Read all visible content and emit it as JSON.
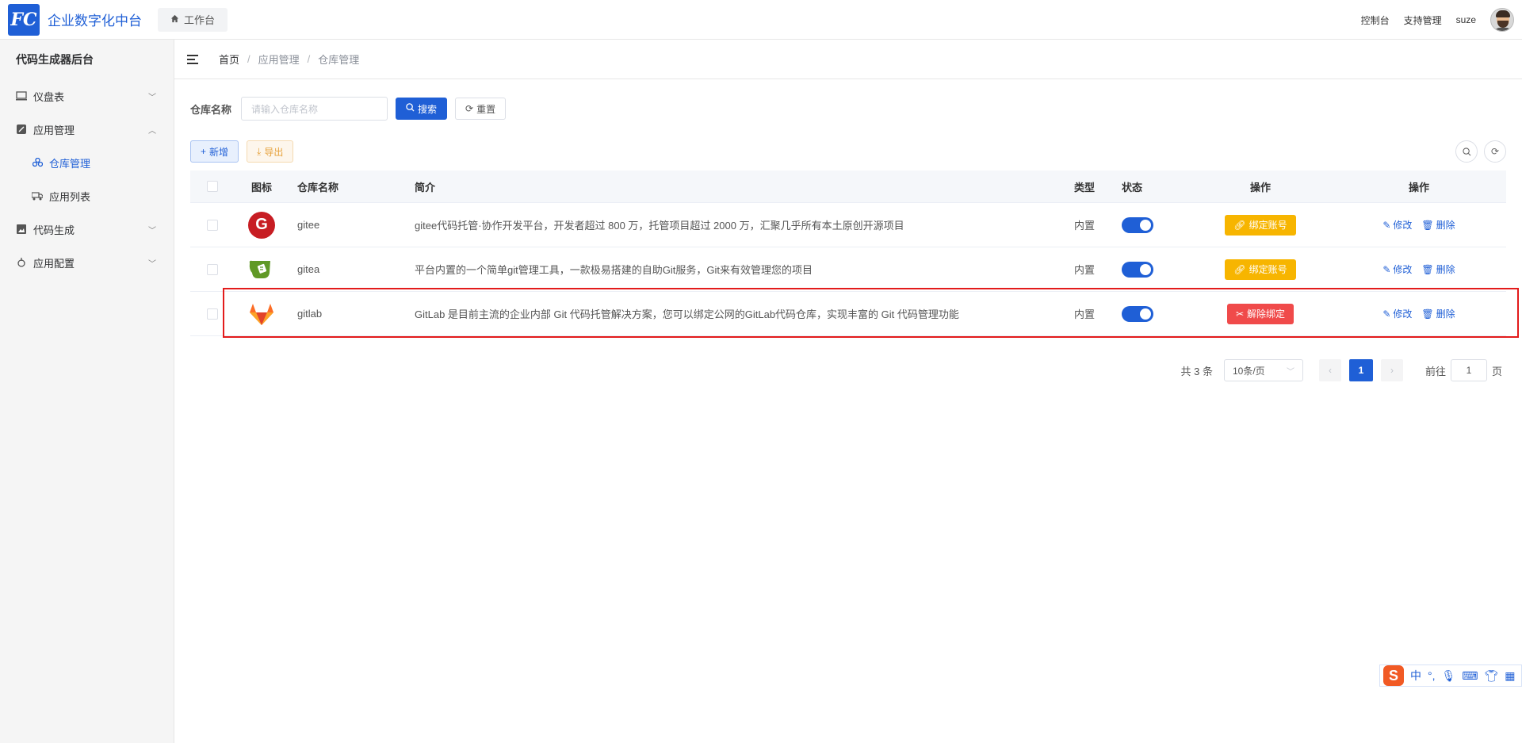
{
  "header": {
    "logo_text": "FC",
    "app_title": "企业数字化中台",
    "workbench_tab": "工作台",
    "links": [
      "控制台",
      "支持管理",
      "suze"
    ]
  },
  "sidebar": {
    "title": "代码生成器后台",
    "items": [
      {
        "label": "仪盘表",
        "icon": "monitor-icon",
        "chevron": "down"
      },
      {
        "label": "应用管理",
        "icon": "app-icon",
        "chevron": "up"
      },
      {
        "label": "仓库管理",
        "icon": "repo-icon",
        "active": true
      },
      {
        "label": "应用列表",
        "icon": "truck-icon"
      },
      {
        "label": "代码生成",
        "icon": "image-icon",
        "chevron": "down"
      },
      {
        "label": "应用配置",
        "icon": "config-icon",
        "chevron": "down"
      }
    ]
  },
  "breadcrumb": [
    "首页",
    "应用管理",
    "仓库管理"
  ],
  "search": {
    "label": "仓库名称",
    "placeholder": "请输入仓库名称",
    "search_btn": "搜索",
    "reset_btn": "重置"
  },
  "actions": {
    "add": "新增",
    "export": "导出"
  },
  "table": {
    "headers": [
      "图标",
      "仓库名称",
      "简介",
      "类型",
      "状态",
      "操作",
      "操作"
    ],
    "rows": [
      {
        "icon": "gitee-logo-icon",
        "name": "gitee",
        "desc": "gitee代码托管·协作开发平台，开发者超过 800 万，托管项目超过 2000 万，汇聚几乎所有本土原创开源项目",
        "type": "内置",
        "enabled": true,
        "bind_label": "绑定账号",
        "bind_state": "bind",
        "edit": "修改",
        "delete": "删除"
      },
      {
        "icon": "gitea-logo-icon",
        "name": "gitea",
        "desc": "平台内置的一个简单git管理工具，一款极易搭建的自助Git服务，Git来有效管理您的项目",
        "type": "内置",
        "enabled": true,
        "bind_label": "绑定账号",
        "bind_state": "bind",
        "edit": "修改",
        "delete": "删除"
      },
      {
        "icon": "gitlab-logo-icon",
        "name": "gitlab",
        "desc": "GitLab 是目前主流的企业内部 Git 代码托管解决方案，您可以绑定公网的GitLab代码仓库，实现丰富的 Git 代码管理功能",
        "type": "内置",
        "enabled": true,
        "bind_label": "解除绑定",
        "bind_state": "unbind",
        "edit": "修改",
        "delete": "删除"
      }
    ]
  },
  "pagination": {
    "total": "共 3 条",
    "page_size": "10条/页",
    "current_page": "1",
    "goto_label": "前往",
    "goto_value": "1",
    "goto_suffix": "页"
  },
  "ime": {
    "logo": "S",
    "mode": "中"
  },
  "colors": {
    "primary": "#1f5fd6",
    "warning": "#f7b500",
    "danger": "#f04a4a",
    "highlight": "#e31b1b"
  }
}
